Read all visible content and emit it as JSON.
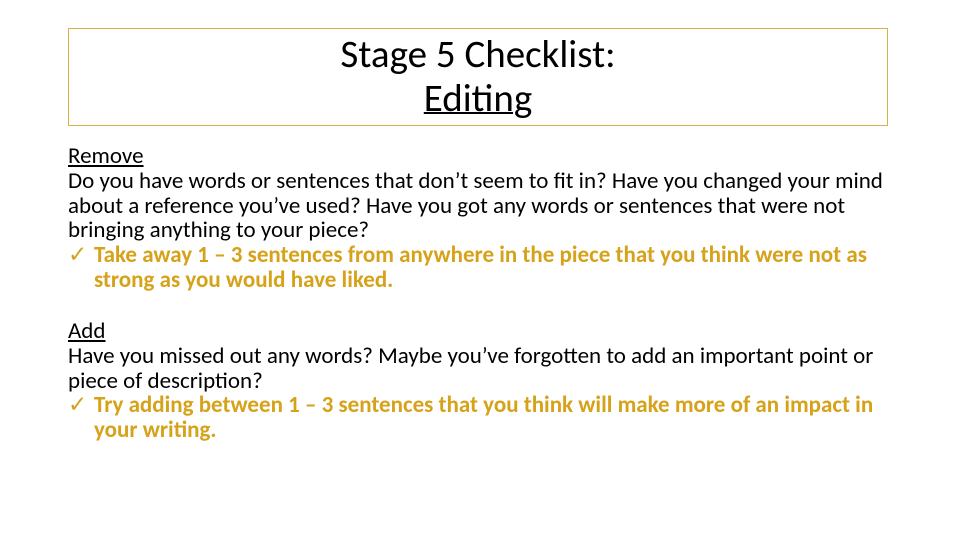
{
  "title": {
    "line1": "Stage 5 Checklist:",
    "line2": "Editing"
  },
  "sections": {
    "remove": {
      "heading": "Remove",
      "text": "Do you have words or sentences that don’t seem to fit in? Have you changed your mind about a reference you’ve used? Have you got any words or sentences that were not bringing anything to your piece?",
      "check": "Take away 1 – 3 sentences from anywhere in the piece that you think were not as strong as you would have liked."
    },
    "add": {
      "heading": "Add",
      "text": "Have you missed out any words? Maybe you’ve forgotten to add an important point or piece of description?",
      "check": "Try adding between 1 – 3 sentences that you think will make more of an impact in your writing."
    }
  },
  "tick": "✓"
}
